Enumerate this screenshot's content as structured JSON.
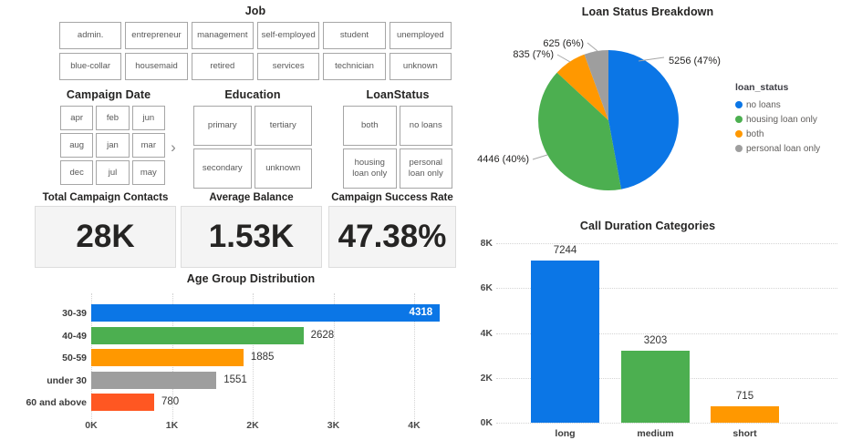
{
  "colors": {
    "blue": "#0b76e6",
    "green": "#4caf50",
    "orange": "#ff9800",
    "gray": "#9e9e9e",
    "deep_orange": "#ff5722"
  },
  "icons": {
    "next_arrow": "›"
  },
  "slicers": {
    "job": {
      "title": "Job",
      "items": [
        "admin.",
        "entrepreneur",
        "management",
        "self-employed",
        "student",
        "unemployed",
        "blue-collar",
        "housemaid",
        "retired",
        "services",
        "technician",
        "unknown"
      ]
    },
    "campaign_date": {
      "title": "Campaign Date",
      "items": [
        "apr",
        "feb",
        "jun",
        "aug",
        "jan",
        "mar",
        "dec",
        "jul",
        "may"
      ]
    },
    "education": {
      "title": "Education",
      "items": [
        "primary",
        "tertiary",
        "secondary",
        "unknown"
      ]
    },
    "loan_status": {
      "title": "LoanStatus",
      "items": [
        "both",
        "no loans",
        "housing loan only",
        "personal loan only"
      ]
    }
  },
  "kpis": [
    {
      "label": "Total Campaign Contacts",
      "value": "28K"
    },
    {
      "label": "Average Balance",
      "value": "1.53K"
    },
    {
      "label": "Campaign Success Rate",
      "value": "47.38%"
    }
  ],
  "chart_data": [
    {
      "type": "bar",
      "orientation": "horizontal",
      "title": "Age Group Distribution",
      "categories": [
        "30-39",
        "40-49",
        "50-59",
        "under 30",
        "60 and above"
      ],
      "values": [
        4318,
        2628,
        1885,
        1551,
        780
      ],
      "colors": [
        "#0b76e6",
        "#4caf50",
        "#ff9800",
        "#9e9e9e",
        "#ff5722"
      ],
      "xticks": [
        "0K",
        "1K",
        "2K",
        "3K",
        "4K"
      ],
      "xlim": [
        0,
        4350
      ],
      "grid": "vertical-dotted",
      "data_labels": [
        "4318",
        "2628",
        "1885",
        "1551",
        "780"
      ]
    },
    {
      "type": "pie",
      "title": "Loan Status Breakdown",
      "legend_title": "loan_status",
      "legend_position": "right",
      "slices": [
        {
          "label": "no loans",
          "value": 5256,
          "pct": 47,
          "data_label": "5256 (47%)",
          "color": "#0b76e6"
        },
        {
          "label": "housing loan only",
          "value": 4446,
          "pct": 40,
          "data_label": "4446 (40%)",
          "color": "#4caf50"
        },
        {
          "label": "both",
          "value": 835,
          "pct": 7,
          "data_label": "835 (7%)",
          "color": "#ff9800"
        },
        {
          "label": "personal loan only",
          "value": 625,
          "pct": 6,
          "data_label": "625 (6%)",
          "color": "#9e9e9e"
        }
      ]
    },
    {
      "type": "bar",
      "orientation": "vertical",
      "title": "Call Duration Categories",
      "categories": [
        "long",
        "medium",
        "short"
      ],
      "values": [
        7244,
        3203,
        715
      ],
      "colors": [
        "#0b76e6",
        "#4caf50",
        "#ff9800"
      ],
      "yticks": [
        "0K",
        "2K",
        "4K",
        "6K",
        "8K"
      ],
      "ylim": [
        0,
        8000
      ],
      "grid": "horizontal-dotted",
      "data_labels": [
        "7244",
        "3203",
        "715"
      ]
    }
  ]
}
